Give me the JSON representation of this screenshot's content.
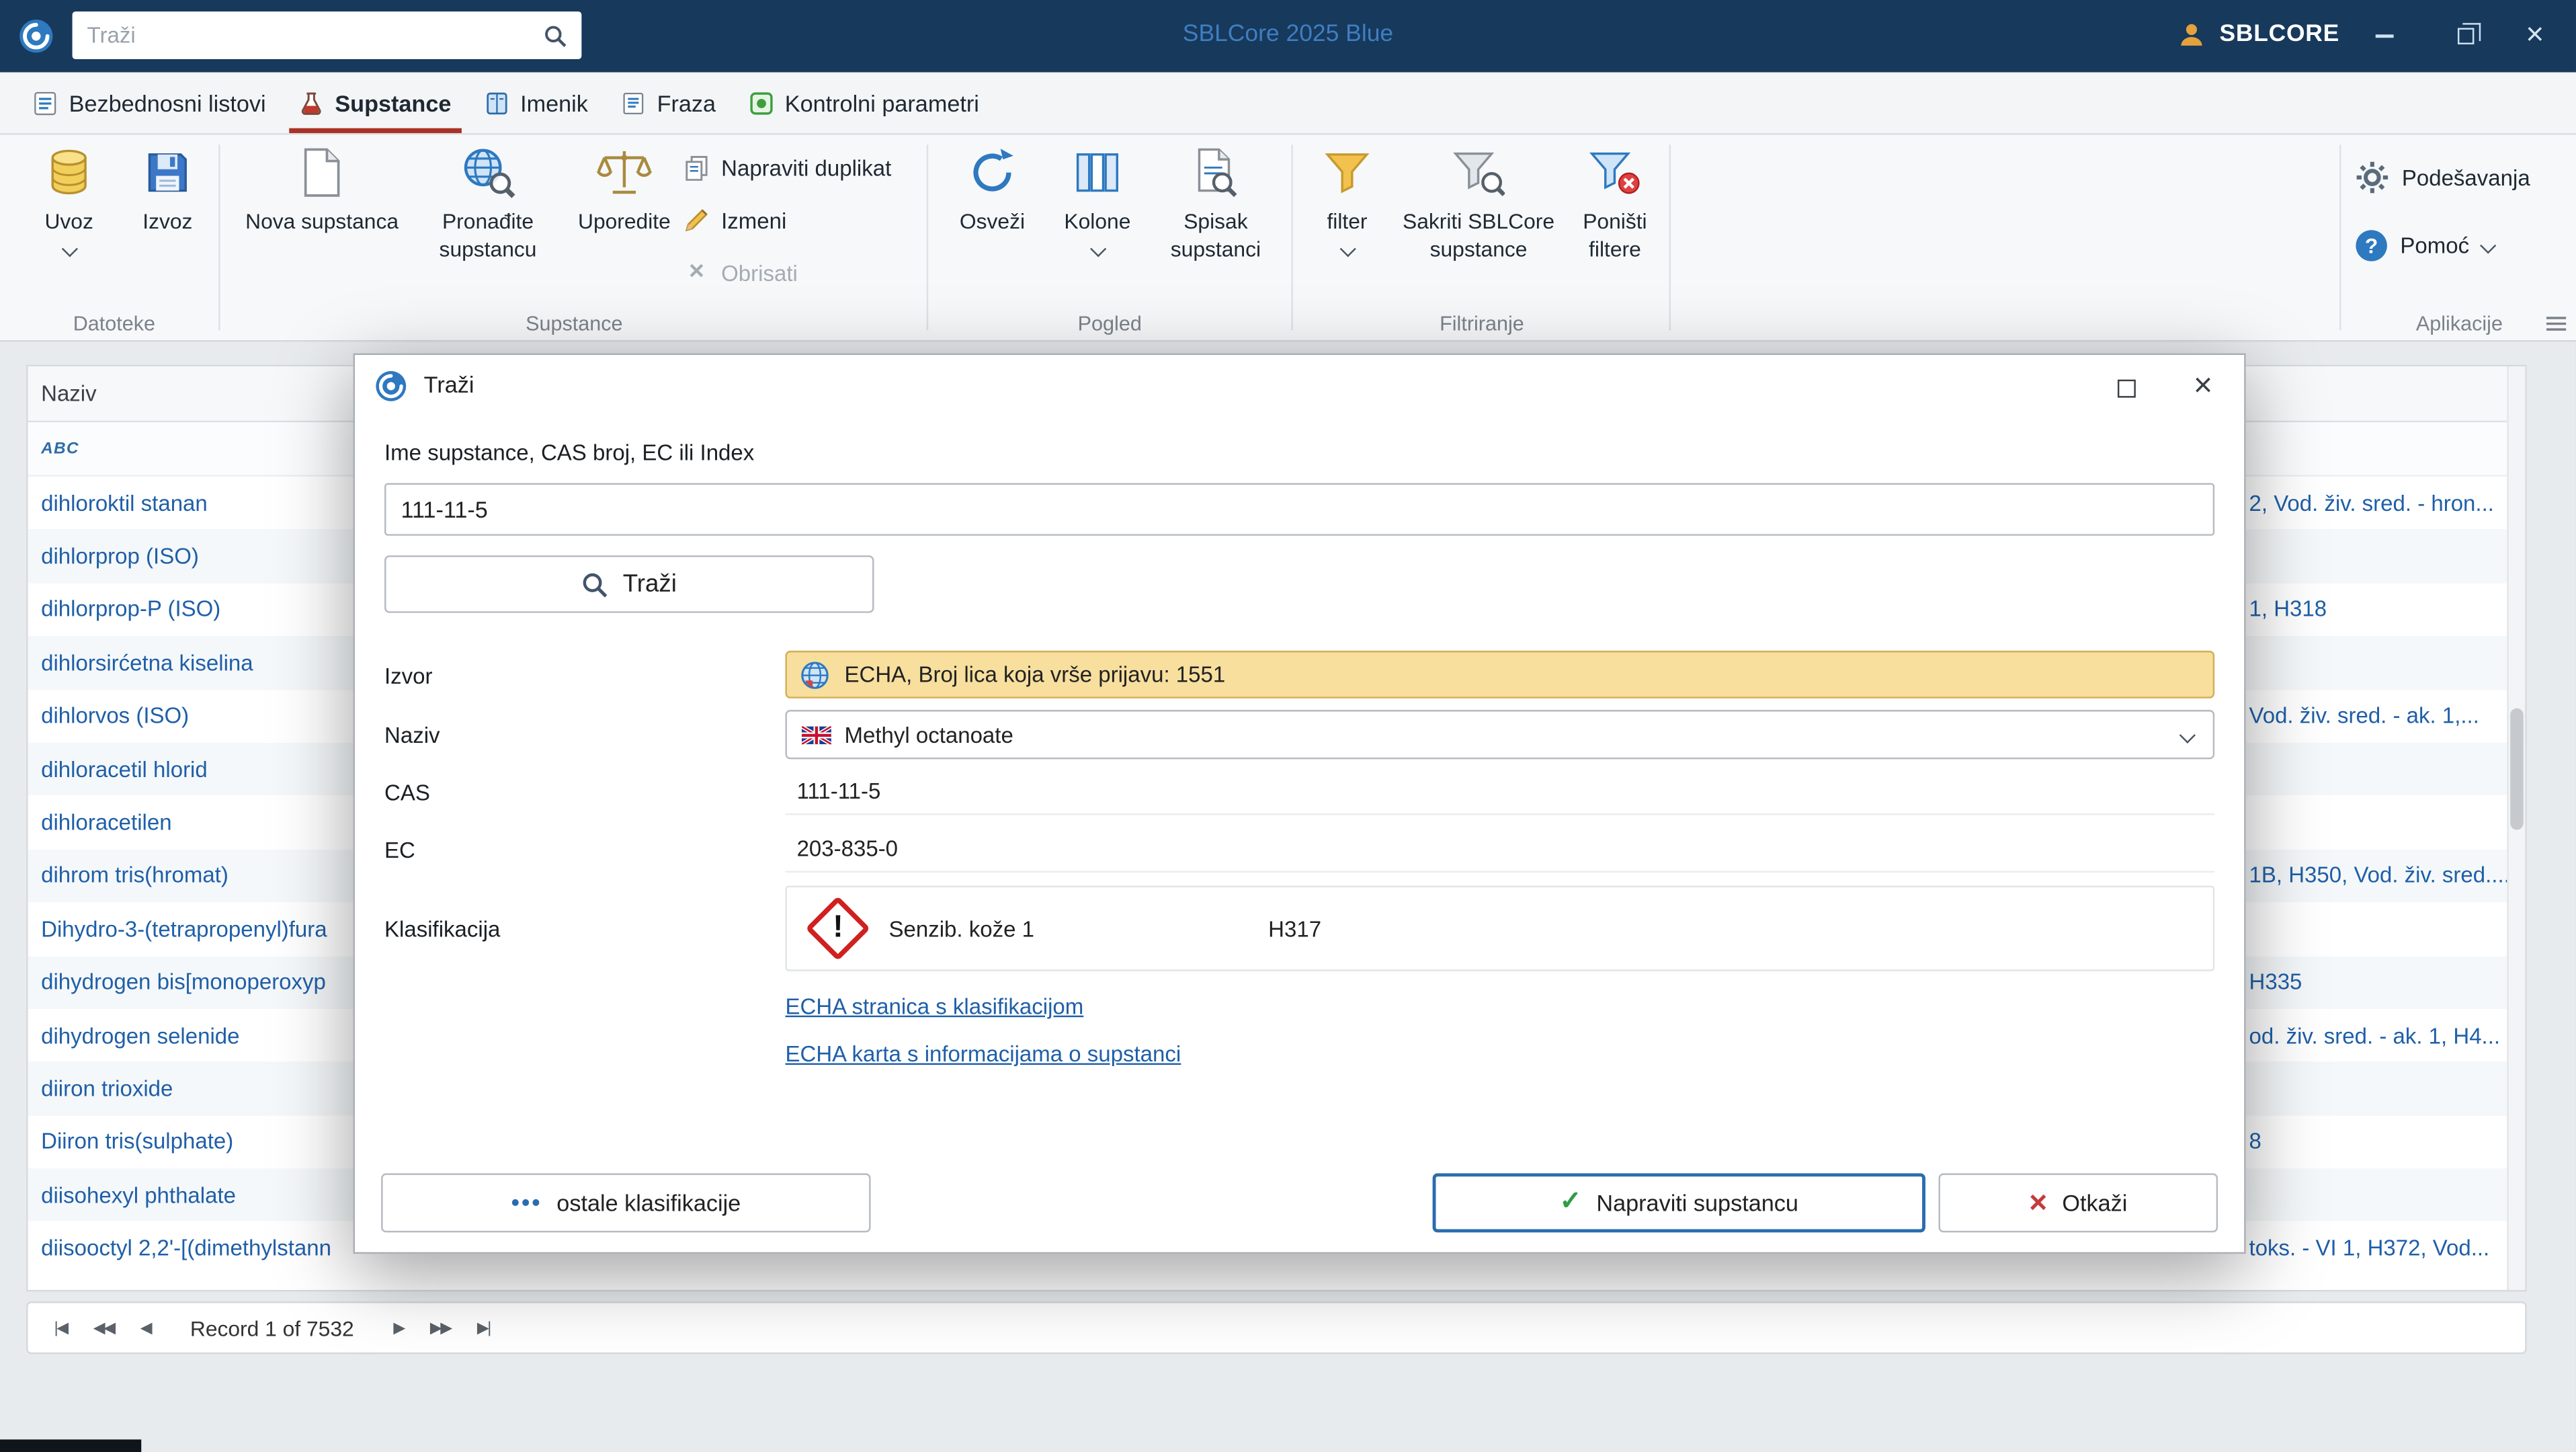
{
  "titlebar": {
    "search_placeholder": "Traži",
    "app_title": "SBLCore 2025 Blue",
    "account": "SBLCORE"
  },
  "tabs": [
    {
      "label": "Bezbednosni listovi"
    },
    {
      "label": "Supstance"
    },
    {
      "label": "Imenik"
    },
    {
      "label": "Fraza"
    },
    {
      "label": "Kontrolni parametri"
    }
  ],
  "ribbon": {
    "uvoz": "Uvoz",
    "izvoz": "Izvoz",
    "group_datoteke": "Datoteke",
    "nova_supstanca": "Nova supstanca",
    "pronadite_supstancu": "Pronađite supstancu",
    "uporedite": "Uporedite",
    "napraviti_duplikat": "Napraviti duplikat",
    "izmeni": "Izmeni",
    "obrisati": "Obrisati",
    "group_supstance": "Supstance",
    "osvezi": "Osveži",
    "kolone": "Kolone",
    "spisak_supstanci": "Spisak supstanci",
    "group_pogled": "Pogled",
    "filter": "filter",
    "sakriti_sblcore": "Sakriti SBLCore supstance",
    "ponisti_filtere": "Poništi filtere",
    "group_filtriranje": "Filtriranje",
    "podesavanja": "Podešavanja",
    "pomoc": "Pomoć",
    "group_aplikacije": "Aplikacije"
  },
  "table": {
    "header": "Naziv",
    "rows": [
      {
        "name": "dihloroktil stanan",
        "right": "2, Vod. živ. sred. - hron..."
      },
      {
        "name": "dihlorprop (ISO)"
      },
      {
        "name": "dihlorprop-P (ISO)",
        "right": "1, H318"
      },
      {
        "name": "dihlorsirćetna kiselina"
      },
      {
        "name": "dihlorvos (ISO)",
        "right": "Vod. živ. sred. - ak. 1,..."
      },
      {
        "name": "dihloracetil hlorid"
      },
      {
        "name": "dihloracetilen"
      },
      {
        "name": "dihrom tris(hromat)",
        "right": "1B, H350, Vod. živ. sred...."
      },
      {
        "name": "Dihydro-3-(tetrapropenyl)fura"
      },
      {
        "name": "dihydrogen bis[monoperoxyp",
        "right": "H335"
      },
      {
        "name": "dihydrogen selenide",
        "right": "od. živ. sred. - ak. 1, H4..."
      },
      {
        "name": "diiron trioxide"
      },
      {
        "name": "Diiron tris(sulphate)",
        "right": "8"
      },
      {
        "name": "diisohexyl phthalate"
      },
      {
        "name": "diisooctyl 2,2'-[(dimethylstann",
        "right": "toks. - VI 1, H372, Vod..."
      }
    ]
  },
  "dialog": {
    "title": "Traži",
    "search_label": "Ime supstance, CAS broj, EC ili Index",
    "search_value": "111-11-5",
    "search_button": "Traži",
    "izvor_label": "Izvor",
    "izvor_value": "ECHA, Broj lica koja vrše prijavu: 1551",
    "naziv_label": "Naziv",
    "naziv_value": "Methyl octanoate",
    "cas_label": "CAS",
    "cas_value": "111-11-5",
    "ec_label": "EC",
    "ec_value": "203-835-0",
    "klas_label": "Klasifikacija",
    "klas_name": "Senzib. kože 1",
    "klas_code": "H317",
    "link_classification": "ECHA stranica s klasifikacijom",
    "link_infocard": "ECHA karta s informacijama o supstanci",
    "btn_ostale": "ostale klasifikacije",
    "btn_napraviti": "Napraviti supstancu",
    "btn_otkazi": "Otkaži"
  },
  "record_nav": {
    "label": "Record 1 of 7532"
  },
  "icons": {
    "close_x": "×",
    "check": "✓",
    "question": "?",
    "exclamation": "!",
    "dots": "•••",
    "abc": "ABC",
    "nav_first": "|◀",
    "nav_prev_fast": "◀◀",
    "nav_prev": "◀",
    "nav_next": "▶",
    "nav_next_fast": "▶▶",
    "nav_last": "▶|"
  },
  "colors": {
    "titlebar_bg": "#17395C",
    "accent_blue": "#2E79C0",
    "link_blue": "#1F5FA8",
    "active_tab_underline": "#A93226",
    "izvor_highlight_bg": "#F8DF9E",
    "ghs_red": "#D02020",
    "confirm_green": "#2E9E44",
    "cancel_red": "#C43B3B"
  }
}
